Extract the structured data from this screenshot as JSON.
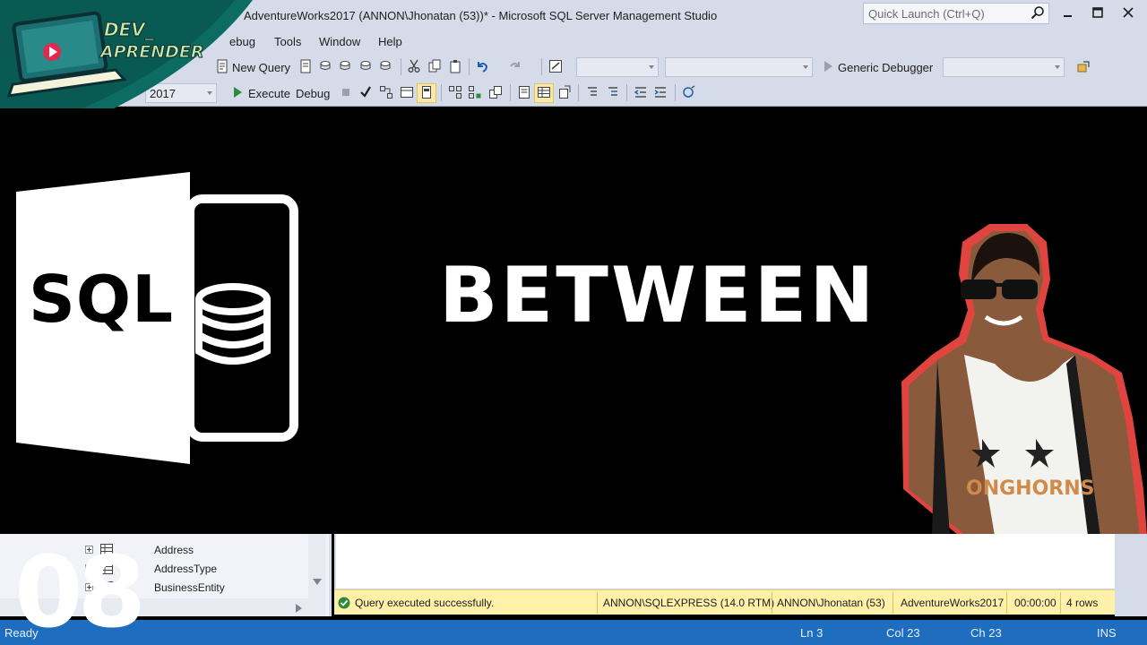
{
  "window": {
    "title": "AdventureWorks2017 (ANNON\\Jhonatan (53))* - Microsoft SQL Server Management Studio",
    "quick_launch_placeholder": "Quick Launch (Ctrl+Q)"
  },
  "menu": [
    "ebug",
    "Tools",
    "Window",
    "Help"
  ],
  "toolbar1": {
    "new_query": "New Query",
    "debugger_combo": "Generic Debugger"
  },
  "toolbar2": {
    "database_combo": "2017",
    "execute": "Execute",
    "debug": "Debug"
  },
  "thumbnail": {
    "channel_logo_line1": "DEV_",
    "channel_logo_line2": "APRENDER",
    "sql_label": "SQL",
    "title": "BETWEEN",
    "episode_number": "08"
  },
  "object_explorer": {
    "items": [
      {
        "label": "Address"
      },
      {
        "label": "AddressType"
      },
      {
        "label": "BusinessEntity"
      }
    ]
  },
  "query_status": {
    "message": "Query executed successfully.",
    "server": "ANNON\\SQLEXPRESS (14.0 RTM)",
    "user": "ANNON\\Jhonatan (53)",
    "database": "AdventureWorks2017",
    "elapsed": "00:00:00",
    "rows": "4 rows"
  },
  "status_bar": {
    "state": "Ready",
    "line": "Ln 3",
    "column": "Col 23",
    "char": "Ch 23",
    "mode": "INS"
  },
  "colors": {
    "chrome": "#d6dbe9",
    "status_bar": "#1f6dbf",
    "query_status": "#fff1a8",
    "logo_teal": "#0c6b63",
    "photo_outline": "#e0443f"
  }
}
